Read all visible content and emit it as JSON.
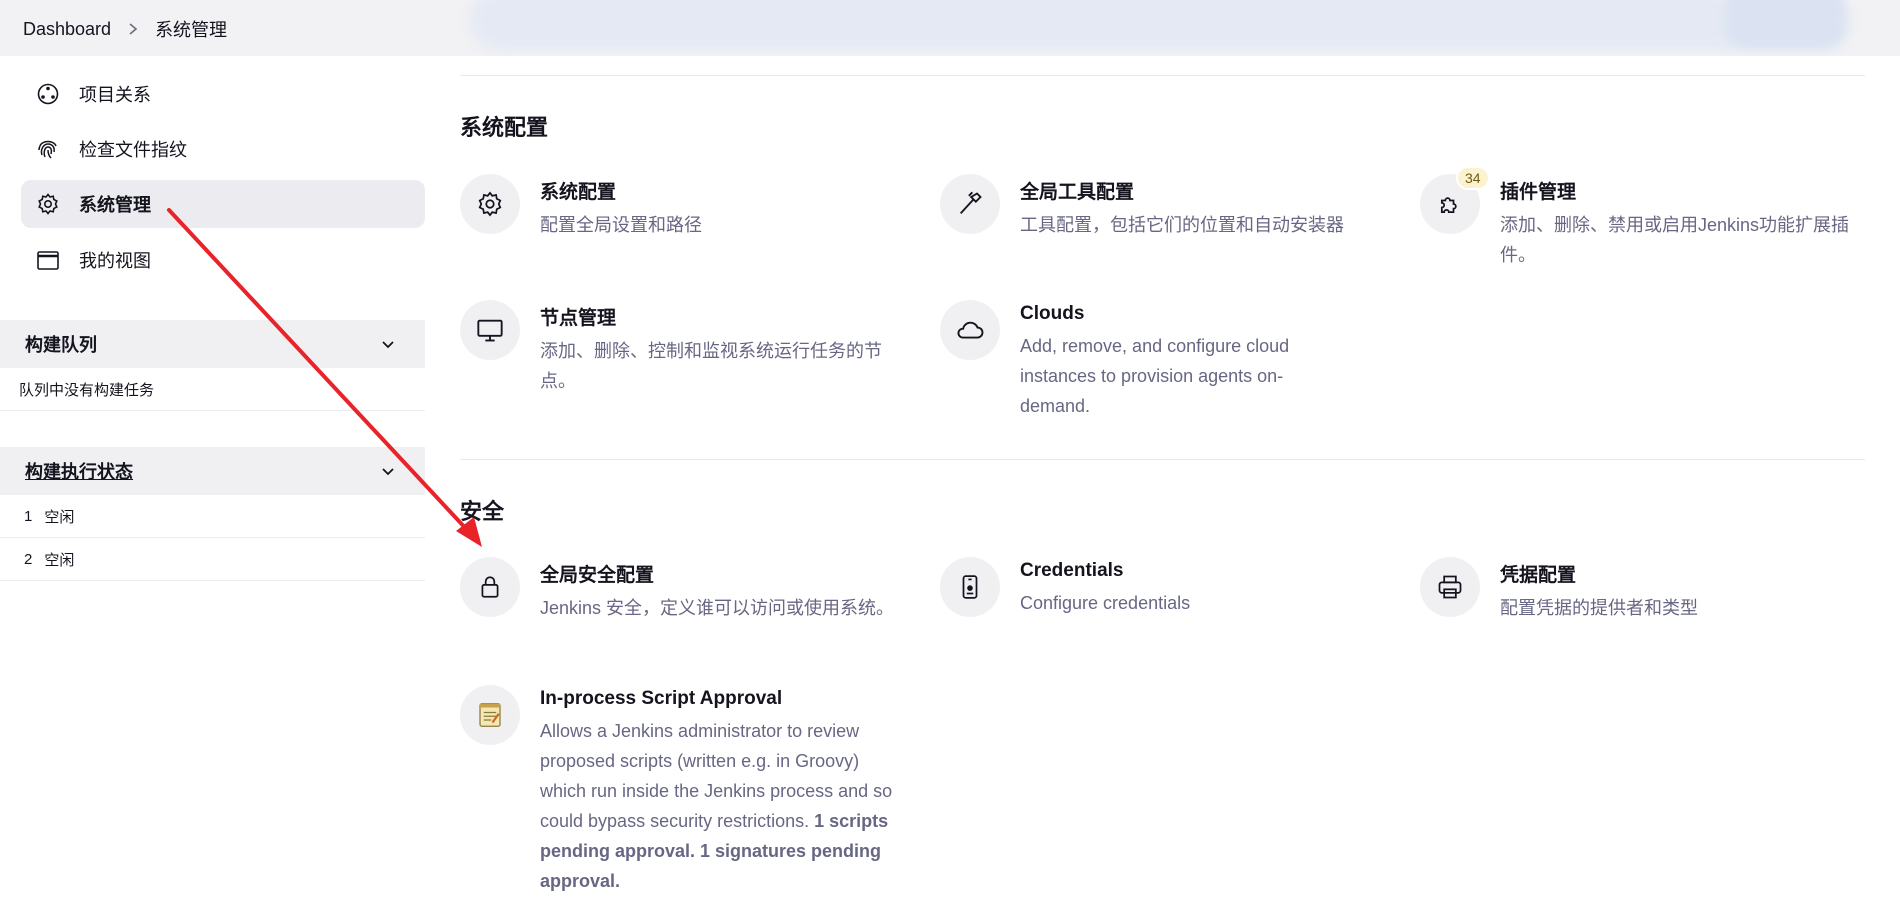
{
  "breadcrumb": {
    "items": [
      "Dashboard",
      "系统管理"
    ],
    "separator": ">"
  },
  "sidebar": {
    "items": [
      {
        "label": "项目关系",
        "icon": "network-icon"
      },
      {
        "label": "检查文件指纹",
        "icon": "fingerprint-icon"
      },
      {
        "label": "系统管理",
        "icon": "gear-icon",
        "active": true
      },
      {
        "label": "我的视图",
        "icon": "window-icon"
      }
    ],
    "build_queue": {
      "title": "构建队列",
      "empty_text": "队列中没有构建任务"
    },
    "executors": {
      "title": "构建执行状态",
      "rows": [
        {
          "num": "1",
          "status": "空闲"
        },
        {
          "num": "2",
          "status": "空闲"
        }
      ]
    }
  },
  "sections": {
    "system_config": {
      "title": "系统配置",
      "cards": [
        {
          "title": "系统配置",
          "desc": "配置全局设置和路径",
          "icon": "gear-icon"
        },
        {
          "title": "全局工具配置",
          "desc": "工具配置，包括它们的位置和自动安装器",
          "icon": "hammer-icon"
        },
        {
          "title": "插件管理",
          "desc": "添加、删除、禁用或启用Jenkins功能扩展插件。",
          "icon": "puzzle-icon",
          "badge": "34"
        },
        {
          "title": "节点管理",
          "desc": "添加、删除、控制和监视系统运行任务的节点。",
          "icon": "monitor-icon"
        },
        {
          "title": "Clouds",
          "desc": "Add, remove, and configure cloud instances to provision agents on-demand.",
          "icon": "cloud-icon"
        }
      ]
    },
    "security": {
      "title": "安全",
      "cards": [
        {
          "title": "全局安全配置",
          "desc": "Jenkins 安全，定义谁可以访问或使用系统。",
          "icon": "lock-icon"
        },
        {
          "title": "Credentials",
          "desc": "Configure credentials",
          "icon": "id-card-icon"
        },
        {
          "title": "凭据配置",
          "desc": "配置凭据的提供者和类型",
          "icon": "printer-icon"
        },
        {
          "title": "In-process Script Approval",
          "desc": "Allows a Jenkins administrator to review proposed scripts (written e.g. in Groovy) which run inside the Jenkins process and so could bypass security restrictions.",
          "desc_bold": "1 scripts pending approval. 1 signatures pending approval.",
          "icon": "notepad-icon"
        }
      ]
    }
  },
  "colors": {
    "annotation_arrow": "#e8232a",
    "active_bg": "#ececf0",
    "muted_text": "#676784"
  }
}
